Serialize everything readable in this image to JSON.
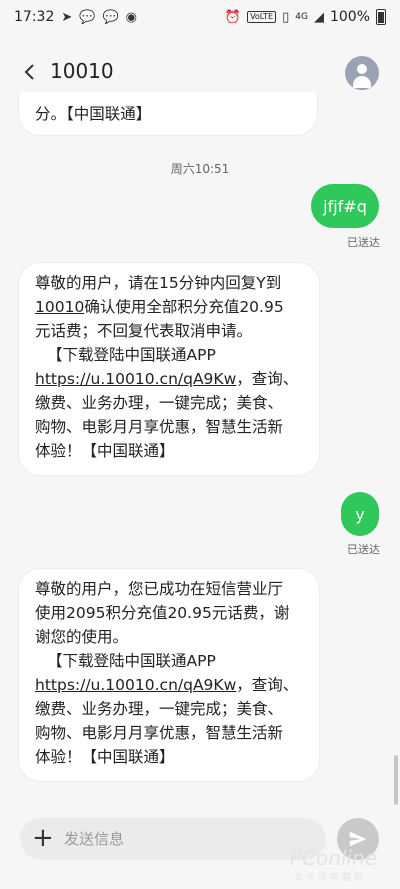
{
  "status_bar": {
    "time": "17:32",
    "volte": "VoLTE",
    "signal": "4G",
    "battery": "100%"
  },
  "header": {
    "contact": "10010"
  },
  "messages": {
    "partial_top": "分。【中国联通】",
    "timestamp": "周六10:51",
    "out1": "jfjf#q",
    "out1_status": "已送达",
    "in1_lines": [
      "尊敬的用户，请在15分钟内回复Y到",
      "10010确认使用全部积分充值20.95",
      "元话费；不回复代表取消申请。",
      "【下载登陆中国联通APP",
      "https://u.10010.cn/qA9Kw，查询、",
      "缴费、业务办理，一键完成；美食、",
      "购物、电影月月享优惠，智慧生活新",
      "体验！【中国联通】"
    ],
    "out2": "y",
    "out2_status": "已送达",
    "in2_lines": [
      "尊敬的用户，您已成功在短信营业厅",
      "使用2095积分充值20.95元话费，谢",
      "谢您的使用。",
      "【下载登陆中国联通APP",
      "https://u.10010.cn/qA9Kw，查询、",
      "缴费、业务办理，一键完成；美食、",
      "购物、电影月月享优惠，智慧生活新",
      "体验！【中国联通】"
    ]
  },
  "composer": {
    "placeholder": "发送信息"
  },
  "watermark": {
    "brand": "PConline",
    "sub": "太平洋电脑网"
  }
}
